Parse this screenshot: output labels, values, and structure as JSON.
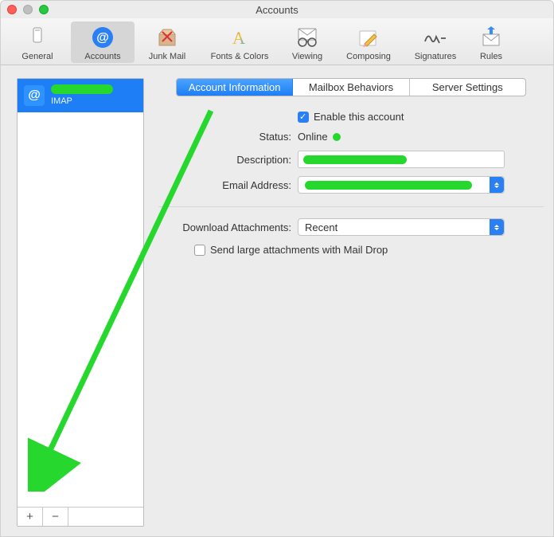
{
  "window": {
    "title": "Accounts"
  },
  "toolbar": {
    "items": [
      {
        "label": "General"
      },
      {
        "label": "Accounts"
      },
      {
        "label": "Junk Mail"
      },
      {
        "label": "Fonts & Colors"
      },
      {
        "label": "Viewing"
      },
      {
        "label": "Composing"
      },
      {
        "label": "Signatures"
      },
      {
        "label": "Rules"
      }
    ]
  },
  "sidebar": {
    "accounts": [
      {
        "type": "IMAP"
      }
    ],
    "add_label": "+",
    "remove_label": "−"
  },
  "tabs": {
    "items": [
      {
        "label": "Account Information"
      },
      {
        "label": "Mailbox Behaviors"
      },
      {
        "label": "Server Settings"
      }
    ]
  },
  "form": {
    "enable_label": "Enable this account",
    "enable_checked": true,
    "status_label": "Status:",
    "status_value": "Online",
    "description_label": "Description:",
    "email_label": "Email Address:",
    "attachments_label": "Download Attachments:",
    "attachments_value": "Recent",
    "maildrop_label": "Send large attachments with Mail Drop",
    "maildrop_checked": false
  }
}
